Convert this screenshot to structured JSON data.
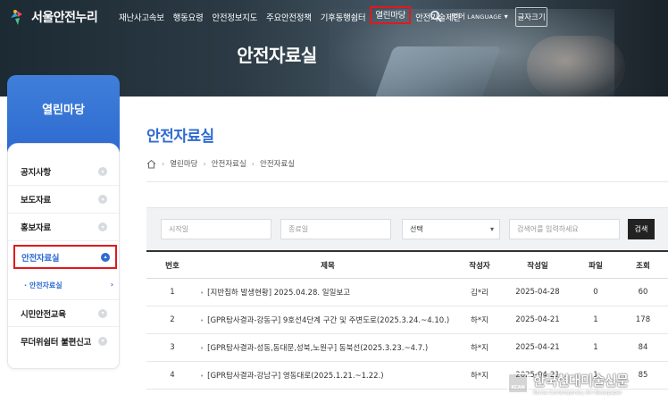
{
  "header": {
    "logo_text": "서울안전누리",
    "nav": [
      {
        "label": "재난사고속보"
      },
      {
        "label": "행동요령"
      },
      {
        "label": "안전정보지도"
      },
      {
        "label": "주요안전정책"
      },
      {
        "label": "기후동행쉼터"
      },
      {
        "label": "열린마당"
      },
      {
        "label": "안전기술제안"
      }
    ],
    "lang_label": "언어",
    "lang_en": "LANGUAGE",
    "font_size_button": "글자크기",
    "hero_title": "안전자료실"
  },
  "sidebar": {
    "title": "열린마당",
    "items": [
      {
        "label": "공지사항"
      },
      {
        "label": "보도자료"
      },
      {
        "label": "홍보자료"
      },
      {
        "label": "안전자료실"
      },
      {
        "label": "시민안전교육"
      },
      {
        "label": "무더위쉼터 불편신고"
      }
    ],
    "sub_item": "안전자료실"
  },
  "main": {
    "page_title": "안전자료실",
    "breadcrumb": [
      "열린마당",
      "안전자료실",
      "안전자료실"
    ],
    "filter": {
      "start_placeholder": "시작일",
      "end_placeholder": "종료일",
      "select_value": "선택",
      "keyword_placeholder": "검색어를 입력하세요",
      "search_button": "검색"
    },
    "table": {
      "headers": {
        "no": "번호",
        "title": "제목",
        "author": "작성자",
        "date": "작성일",
        "file": "파일",
        "views": "조회"
      },
      "rows": [
        {
          "no": "1",
          "title": "[지반침하 발생현황] 2025.04.28. 일일보고",
          "author": "김*리",
          "date": "2025-04-28",
          "file": "0",
          "views": "60"
        },
        {
          "no": "2",
          "title": "[GPR탐사결과-강동구] 9호선4단계 구간 및 주변도로(2025.3.24.~4.10.)",
          "author": "하*지",
          "date": "2025-04-21",
          "file": "1",
          "views": "178"
        },
        {
          "no": "3",
          "title": "[GPR탐사결과-성동,동대문,성북,노원구] 동북선(2025.3.23.~4.7.)",
          "author": "하*지",
          "date": "2025-04-21",
          "file": "1",
          "views": "84"
        },
        {
          "no": "4",
          "title": "[GPR탐사결과-강남구] 영동대로(2025.1.21.~1.22.)",
          "author": "하*지",
          "date": "2025-04-21",
          "file": "1",
          "views": "85"
        }
      ]
    }
  },
  "watermark": {
    "logo_text": "KCAN",
    "korean": "한국현대미술신문",
    "english": "Korea Contemporary Art Newspaper"
  },
  "colors": {
    "accent": "#2f6bd1",
    "highlight": "#e0191e"
  }
}
